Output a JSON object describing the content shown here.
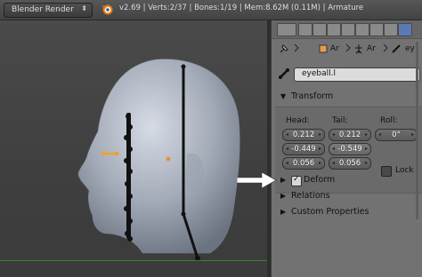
{
  "header": {
    "render_engine": "Blender Render",
    "engine_arrow": "⬍",
    "info": "v2.69 | Verts:2/37 | Bones:1/19 | Mem:8.62M (0.11M) | Armature"
  },
  "properties": {
    "breadcrumbs": [
      "Ar",
      "Ar",
      "ey"
    ],
    "bone_name": "eyeball.l",
    "transform": {
      "title": "Transform",
      "head_label": "Head:",
      "tail_label": "Tail:",
      "roll_label": "Roll:",
      "head": [
        "0.212",
        "-0.449",
        "0.056"
      ],
      "tail": [
        "0.212",
        "-0.549",
        "0.056"
      ],
      "roll": "0°",
      "lock_label": "Lock"
    },
    "sections": {
      "deform": "Deform",
      "relations": "Relations",
      "custom_properties": "Custom Properties"
    }
  },
  "colors": {
    "accent": "#5a7ab4",
    "bone_highlight": "#f0a030",
    "head_mesh": "#8f98a8"
  }
}
